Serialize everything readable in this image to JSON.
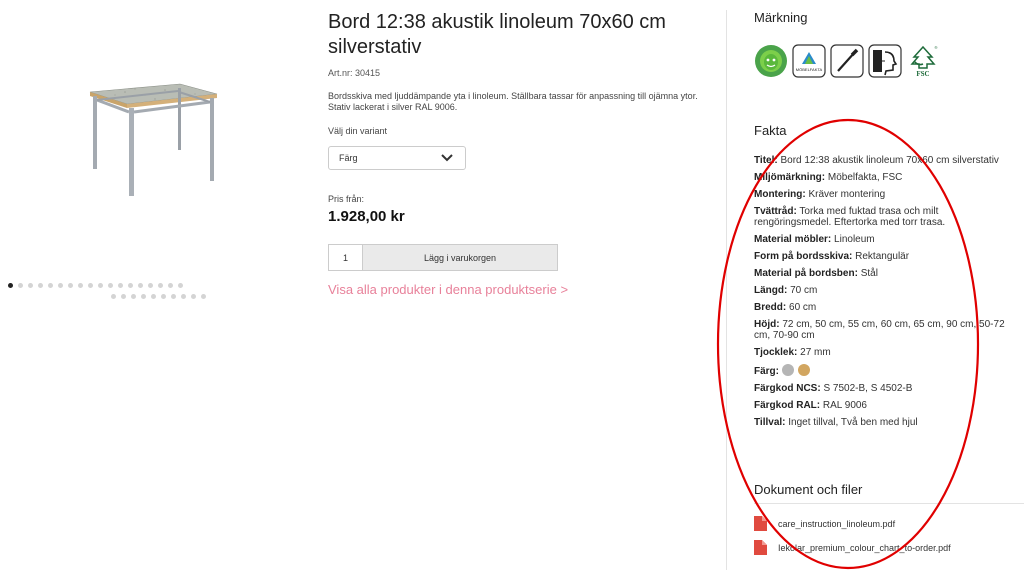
{
  "gallery": {
    "dots_row1_count": 18,
    "dots_row2_count": 10,
    "active_dot": 0
  },
  "product": {
    "title": "Bord 12:38 akustik linoleum 70x60 cm silverstativ",
    "artnr": "Art.nr: 30415",
    "description": "Bordsskiva med ljuddämpande yta i linoleum. Ställbara tassar för anpassning till ojämna ytor. Stativ lackerat i silver RAL 9006.",
    "variant_label": "Välj din variant",
    "variant_select": "Färg",
    "price_label": "Pris från:",
    "price": "1.928,00 kr",
    "quantity": "1",
    "add_to_cart": "Lägg i varukorgen",
    "series_link": "Visa alla produkter i denna produktserie >"
  },
  "marking": {
    "title": "Märkning",
    "badges": [
      "safety-certified-badge",
      "mobelfakta-badge",
      "tool-badge",
      "user-face-badge",
      "fsc-badge"
    ],
    "badge_texts": {
      "mobelfakta": "MÖBELFAKTA",
      "fsc": "FSC"
    }
  },
  "fakta": {
    "title": "Fakta",
    "items": [
      {
        "label": "Titel:",
        "value": "Bord 12:38 akustik linoleum 70x60 cm silverstativ"
      },
      {
        "label": "Miljömärkning:",
        "value": "Möbelfakta, FSC"
      },
      {
        "label": "Montering:",
        "value": "Kräver montering"
      },
      {
        "label": "Tvättråd:",
        "value": "Torka med fuktad trasa och milt rengöringsmedel. Eftertorka med torr trasa."
      },
      {
        "label": "Material möbler:",
        "value": "Linoleum"
      },
      {
        "label": "Form på bordsskiva:",
        "value": "Rektangulär"
      },
      {
        "label": "Material på bordsben:",
        "value": "Stål"
      },
      {
        "label": "Längd:",
        "value": "70 cm"
      },
      {
        "label": "Bredd:",
        "value": "60 cm"
      },
      {
        "label": "Höjd:",
        "value": "72 cm, 50 cm, 55 cm, 60 cm, 65 cm, 90 cm, 50-72 cm, 70-90 cm"
      },
      {
        "label": "Tjocklek:",
        "value": "27 mm"
      }
    ],
    "color_label": "Färg:",
    "color_swatches": [
      "#b5b5b5",
      "#d2a660"
    ],
    "items_after": [
      {
        "label": "Färgkod NCS:",
        "value": "S 7502-B, S 4502-B"
      },
      {
        "label": "Färgkod RAL:",
        "value": "RAL 9006"
      },
      {
        "label": "Tillval:",
        "value": "Inget tillval, Två ben med hjul"
      }
    ]
  },
  "documents": {
    "title": "Dokument och filer",
    "files": [
      "care_instruction_linoleum.pdf",
      "Iekolar_premium_colour_chart_to-order.pdf"
    ]
  },
  "colors": {
    "link_pink": "#e8819a",
    "annotation_red": "#e00000",
    "pdf_red": "#e04a3f"
  }
}
